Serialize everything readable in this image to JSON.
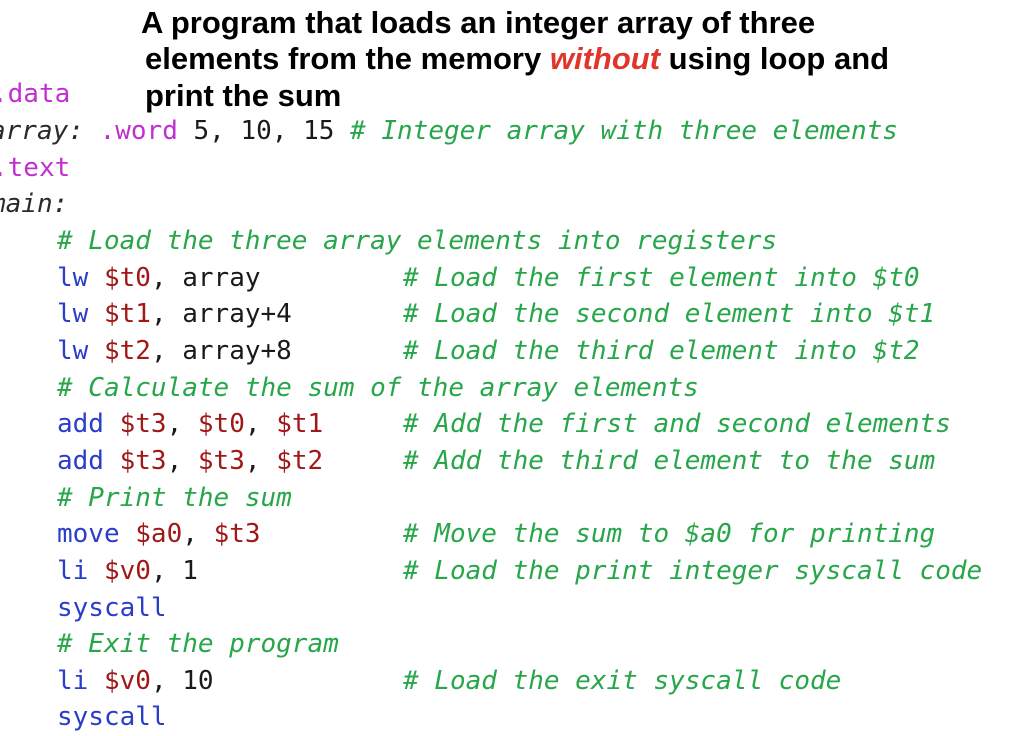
{
  "title": {
    "line1": "A program that loads an integer array of three",
    "line2_pre": "elements from the memory ",
    "line2_em": "without",
    "line2_post": " using loop and",
    "line3": "print the sum"
  },
  "code": {
    "l_data": ".data",
    "l_array_label": "array:",
    "l_array_word": ".word",
    "l_array_vals": " 5, 10, 15 ",
    "l_array_cmt": "# Integer array with three elements",
    "l_text": ".text",
    "l_main": "main:",
    "c1": "# Load the three array elements into registers",
    "r1_op": "lw",
    "r1_reg": "$t0",
    "r1_rest": ", array",
    "r1_cmt": "# Load the first element into $t0",
    "r2_op": "lw",
    "r2_reg": "$t1",
    "r2_rest": ", array+4",
    "r2_cmt": "# Load the second element into $t1",
    "r3_op": "lw",
    "r3_reg": "$t2",
    "r3_rest": ", array+8",
    "r3_cmt": "# Load the third element into $t2",
    "c2": "# Calculate the sum of the array elements",
    "r4_op": "add",
    "r4_a": "$t3",
    "r4_b": "$t0",
    "r4_c": "$t1",
    "r4_cmt": "# Add the first and second elements",
    "r5_op": "add",
    "r5_a": "$t3",
    "r5_b": "$t3",
    "r5_c": "$t2",
    "r5_cmt": "# Add the third element to the sum",
    "c3": "# Print the sum",
    "r6_op": "move",
    "r6_a": "$a0",
    "r6_b": "$t3",
    "r6_cmt": "# Move the sum to $a0 for printing",
    "r7_op": "li",
    "r7_reg": "$v0",
    "r7_rest": ", 1",
    "r7_cmt": "# Load the print integer syscall code",
    "r8_op": "syscall",
    "c4": "# Exit the program",
    "r9_op": "li",
    "r9_reg": "$v0",
    "r9_rest": ", 10",
    "r9_cmt": "# Load the exit syscall code",
    "r10_op": "syscall",
    "comma": ", "
  }
}
